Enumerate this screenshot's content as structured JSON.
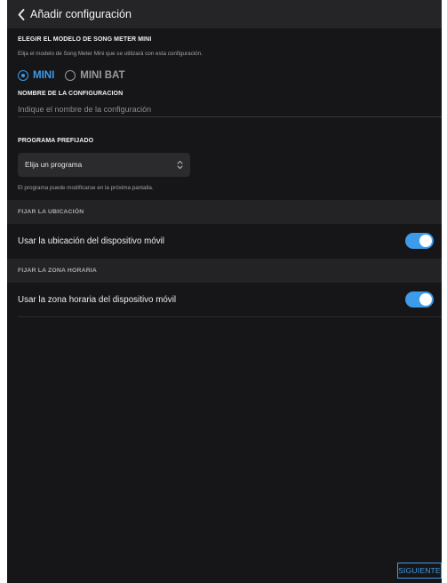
{
  "header": {
    "back_icon": "chevron-left-icon",
    "title": "Añadir configuración"
  },
  "model_section": {
    "title": "ELEGIR EL MODELO DE SONG METER MINI",
    "description": "Elija el modelo de Song Meter Mini que se utilizará con esta configuración.",
    "options": [
      {
        "label": "MINI",
        "selected": true
      },
      {
        "label": "MINI BAT",
        "selected": false
      }
    ]
  },
  "name_section": {
    "title": "NOMBRE DE LA CONFIGURACION",
    "placeholder": "Indique el nombre de la configuración"
  },
  "program_section": {
    "title": "PROGRAMA PREFIJADO",
    "select_value": "Elija un programa",
    "select_icon": "chevron-up-down-icon",
    "note": "El programa puede modificarse en la próxima pantalla."
  },
  "location": {
    "header": "FIJAR LA UBICACIÓN",
    "toggle_label": "Usar la ubicación del dispositivo móvil",
    "enabled": true
  },
  "timezone": {
    "header": "FIJAR LA ZONA HORARIA",
    "toggle_label": "Usar la zona horaria del dispositivo móvil",
    "enabled": true
  },
  "footer": {
    "next_label": "SIGUIENTE"
  },
  "colors": {
    "accent": "#3d9be9",
    "background": "#161618",
    "section_header": "#232325"
  }
}
